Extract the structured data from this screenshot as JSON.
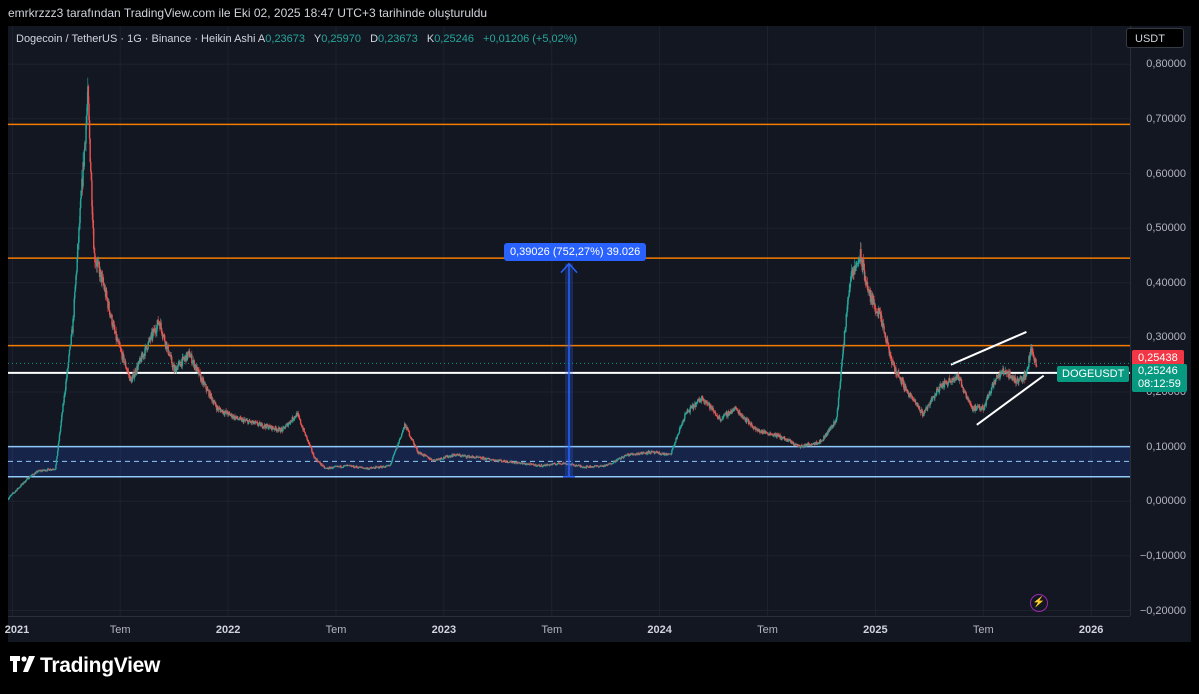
{
  "caption": "emrkrzzz3 tarafından TradingView.com ile Eki 02, 2025 18:47 UTC+3 tarihinde oluşturuldu",
  "legend": {
    "symbol": "Dogecoin / TetherUS · 1G · Binance · Heikin Ashi",
    "open_label": "A",
    "open": "0,23673",
    "high_label": "Y",
    "high": "0,25970",
    "low_label": "D",
    "low": "0,23673",
    "close_label": "K",
    "close": "0,25246",
    "change": "+0,01206 (+5,02%)"
  },
  "currency": "USDT",
  "price_tags": {
    "red": "0,25438",
    "green": "0,25246",
    "countdown": "08:12:59",
    "symbol": "DOGEUSDT"
  },
  "measure": {
    "label": "0,39026 (752,27%) 39.026"
  },
  "brand": "TradingView",
  "icons": {
    "flash": "lightning-icon",
    "logo": "tradingview-logo-icon"
  },
  "colors": {
    "up": "#26a69a",
    "down": "#ef5350",
    "level": "#f57c00",
    "support": "#ffffff",
    "zone": "#90caf9",
    "measure": "#2962ff"
  },
  "chart_data": {
    "type": "candlestick",
    "title": "Dogecoin / TetherUS · 1G · Binance · Heikin Ashi",
    "y_ticks": [
      "0,80000",
      "0,70000",
      "0,60000",
      "0,50000",
      "0,40000",
      "0,30000",
      "0,20000",
      "0,10000",
      "0,00000",
      "−0,10000",
      "−0,20000"
    ],
    "y_tick_values": [
      0.8,
      0.7,
      0.6,
      0.5,
      0.4,
      0.3,
      0.2,
      0.1,
      0.0,
      -0.1,
      -0.2
    ],
    "ylim": [
      -0.21,
      0.87
    ],
    "x_ticks": [
      {
        "label": "2021",
        "year": true,
        "t": 2021.0
      },
      {
        "label": "Tem",
        "year": false,
        "t": 2021.5
      },
      {
        "label": "2022",
        "year": true,
        "t": 2022.0
      },
      {
        "label": "Tem",
        "year": false,
        "t": 2022.5
      },
      {
        "label": "2023",
        "year": true,
        "t": 2023.0
      },
      {
        "label": "Tem",
        "year": false,
        "t": 2023.5
      },
      {
        "label": "2024",
        "year": true,
        "t": 2024.0
      },
      {
        "label": "Tem",
        "year": false,
        "t": 2024.5
      },
      {
        "label": "2025",
        "year": true,
        "t": 2025.0
      },
      {
        "label": "Tem",
        "year": false,
        "t": 2025.5
      },
      {
        "label": "2026",
        "year": true,
        "t": 2026.0
      }
    ],
    "xlim": [
      2020.98,
      2026.18
    ],
    "price_path": [
      [
        2020.98,
        0.005
      ],
      [
        2021.08,
        0.045
      ],
      [
        2021.12,
        0.055
      ],
      [
        2021.2,
        0.06
      ],
      [
        2021.28,
        0.32
      ],
      [
        2021.35,
        0.74
      ],
      [
        2021.38,
        0.45
      ],
      [
        2021.42,
        0.4
      ],
      [
        2021.48,
        0.3
      ],
      [
        2021.55,
        0.22
      ],
      [
        2021.62,
        0.28
      ],
      [
        2021.68,
        0.33
      ],
      [
        2021.75,
        0.24
      ],
      [
        2021.82,
        0.27
      ],
      [
        2021.88,
        0.22
      ],
      [
        2021.95,
        0.17
      ],
      [
        2022.05,
        0.15
      ],
      [
        2022.15,
        0.14
      ],
      [
        2022.25,
        0.13
      ],
      [
        2022.32,
        0.16
      ],
      [
        2022.4,
        0.08
      ],
      [
        2022.45,
        0.06
      ],
      [
        2022.55,
        0.065
      ],
      [
        2022.65,
        0.06
      ],
      [
        2022.75,
        0.065
      ],
      [
        2022.82,
        0.14
      ],
      [
        2022.88,
        0.09
      ],
      [
        2022.95,
        0.075
      ],
      [
        2023.05,
        0.085
      ],
      [
        2023.15,
        0.08
      ],
      [
        2023.25,
        0.075
      ],
      [
        2023.35,
        0.07
      ],
      [
        2023.45,
        0.065
      ],
      [
        2023.55,
        0.07
      ],
      [
        2023.65,
        0.063
      ],
      [
        2023.75,
        0.065
      ],
      [
        2023.85,
        0.085
      ],
      [
        2023.95,
        0.09
      ],
      [
        2024.05,
        0.085
      ],
      [
        2024.12,
        0.16
      ],
      [
        2024.2,
        0.19
      ],
      [
        2024.28,
        0.15
      ],
      [
        2024.35,
        0.17
      ],
      [
        2024.45,
        0.13
      ],
      [
        2024.55,
        0.12
      ],
      [
        2024.65,
        0.1
      ],
      [
        2024.75,
        0.11
      ],
      [
        2024.82,
        0.15
      ],
      [
        2024.88,
        0.4
      ],
      [
        2024.93,
        0.45
      ],
      [
        2024.97,
        0.38
      ],
      [
        2025.02,
        0.34
      ],
      [
        2025.08,
        0.25
      ],
      [
        2025.15,
        0.2
      ],
      [
        2025.22,
        0.16
      ],
      [
        2025.3,
        0.21
      ],
      [
        2025.38,
        0.23
      ],
      [
        2025.45,
        0.17
      ],
      [
        2025.5,
        0.17
      ],
      [
        2025.55,
        0.22
      ],
      [
        2025.6,
        0.24
      ],
      [
        2025.65,
        0.22
      ],
      [
        2025.7,
        0.23
      ],
      [
        2025.72,
        0.28
      ],
      [
        2025.75,
        0.25
      ]
    ],
    "horizontal_levels": [
      {
        "price": 0.69,
        "color": "#f57c00"
      },
      {
        "price": 0.445,
        "color": "#f57c00"
      },
      {
        "price": 0.285,
        "color": "#f57c00"
      },
      {
        "price": 0.235,
        "color": "#ffffff"
      }
    ],
    "zone": {
      "top": 0.1,
      "bottom": 0.045,
      "mid": 0.073
    },
    "measure": {
      "t": 2023.58,
      "from": 0.045,
      "to": 0.435
    },
    "channel": {
      "upper": [
        [
          2025.35,
          0.25
        ],
        [
          2025.7,
          0.31
        ]
      ],
      "lower": [
        [
          2025.47,
          0.14
        ],
        [
          2025.78,
          0.23
        ]
      ]
    }
  }
}
